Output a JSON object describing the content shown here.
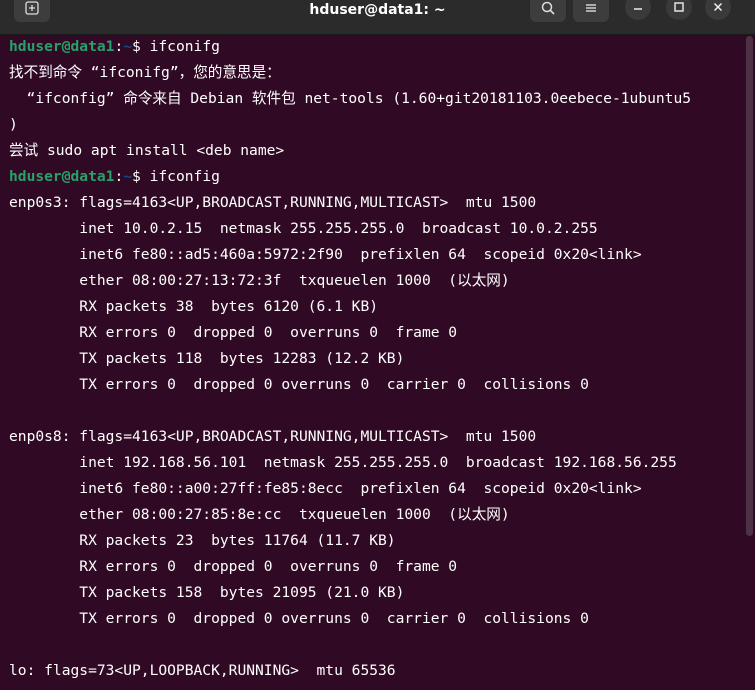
{
  "window": {
    "title": "hduser@data1: ~"
  },
  "prompt": {
    "user_host": "hduser@data1",
    "colon": ":",
    "path": "~",
    "dollar": "$ "
  },
  "lines": [
    {
      "type": "prompt",
      "cmd": "ifconifg"
    },
    {
      "type": "text",
      "text": "找不到命令 “ifconifg”，您的意思是："
    },
    {
      "type": "text",
      "text": "  “ifconfig” 命令来自 Debian 软件包 net-tools (1.60+git20181103.0eebece-1ubuntu5"
    },
    {
      "type": "text",
      "text": ")"
    },
    {
      "type": "text",
      "text": "尝试 sudo apt install <deb name>"
    },
    {
      "type": "prompt",
      "cmd": "ifconfig"
    },
    {
      "type": "text",
      "text": "enp0s3: flags=4163<UP,BROADCAST,RUNNING,MULTICAST>  mtu 1500"
    },
    {
      "type": "text",
      "text": "        inet 10.0.2.15  netmask 255.255.255.0  broadcast 10.0.2.255"
    },
    {
      "type": "text",
      "text": "        inet6 fe80::ad5:460a:5972:2f90  prefixlen 64  scopeid 0x20<link>"
    },
    {
      "type": "text",
      "text": "        ether 08:00:27:13:72:3f  txqueuelen 1000  (以太网)"
    },
    {
      "type": "text",
      "text": "        RX packets 38  bytes 6120 (6.1 KB)"
    },
    {
      "type": "text",
      "text": "        RX errors 0  dropped 0  overruns 0  frame 0"
    },
    {
      "type": "text",
      "text": "        TX packets 118  bytes 12283 (12.2 KB)"
    },
    {
      "type": "text",
      "text": "        TX errors 0  dropped 0 overruns 0  carrier 0  collisions 0"
    },
    {
      "type": "text",
      "text": ""
    },
    {
      "type": "text",
      "text": "enp0s8: flags=4163<UP,BROADCAST,RUNNING,MULTICAST>  mtu 1500"
    },
    {
      "type": "text",
      "text": "        inet 192.168.56.101  netmask 255.255.255.0  broadcast 192.168.56.255"
    },
    {
      "type": "text",
      "text": "        inet6 fe80::a00:27ff:fe85:8ecc  prefixlen 64  scopeid 0x20<link>"
    },
    {
      "type": "text",
      "text": "        ether 08:00:27:85:8e:cc  txqueuelen 1000  (以太网)"
    },
    {
      "type": "text",
      "text": "        RX packets 23  bytes 11764 (11.7 KB)"
    },
    {
      "type": "text",
      "text": "        RX errors 0  dropped 0  overruns 0  frame 0"
    },
    {
      "type": "text",
      "text": "        TX packets 158  bytes 21095 (21.0 KB)"
    },
    {
      "type": "text",
      "text": "        TX errors 0  dropped 0 overruns 0  carrier 0  collisions 0"
    },
    {
      "type": "text",
      "text": ""
    },
    {
      "type": "text",
      "text": "lo: flags=73<UP,LOOPBACK,RUNNING>  mtu 65536"
    }
  ],
  "icons": {
    "new_tab": "new-tab-icon",
    "search": "search-icon",
    "menu": "hamburger-menu-icon",
    "minimize": "minimize-icon",
    "maximize": "maximize-icon",
    "close": "close-icon"
  },
  "colors": {
    "background": "#300a24",
    "user_host": "#26a269",
    "path": "#12488b",
    "text": "#ffffff",
    "titlebar": "#2b2b2b"
  }
}
